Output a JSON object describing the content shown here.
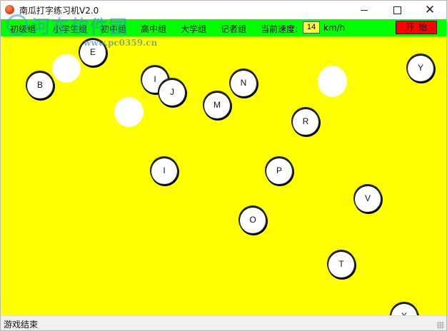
{
  "window": {
    "title": "南瓜打字练习机V2.0"
  },
  "menu": {
    "items": [
      "初级组",
      "小学生组",
      "初中组",
      "高中组",
      "大学组",
      "记者组"
    ],
    "speed_label": "当前速度:",
    "speed_value": "14",
    "speed_unit": "km/h",
    "start_label": "开始"
  },
  "watermark": {
    "text": "河东软件园",
    "url": "www.pc0359.cn"
  },
  "game": {
    "background_color": "#ffff00",
    "balls": [
      {
        "letter": "E"
      },
      {
        "letter": ""
      },
      {
        "letter": "B"
      },
      {
        "letter": "I"
      },
      {
        "letter": "J"
      },
      {
        "letter": "N"
      },
      {
        "letter": ""
      },
      {
        "letter": "Y"
      },
      {
        "letter": ""
      },
      {
        "letter": "M"
      },
      {
        "letter": "R"
      },
      {
        "letter": "I"
      },
      {
        "letter": "P"
      },
      {
        "letter": "V"
      },
      {
        "letter": "O"
      },
      {
        "letter": "T"
      },
      {
        "letter": "X"
      }
    ]
  },
  "status": {
    "text": "游戏结束"
  },
  "colors": {
    "menubar": "#00ff00",
    "start_button": "#ff0000",
    "speed_box": "#ffff33",
    "game_area": "#ffff00"
  },
  "icons": {
    "app": "pumpkin-icon",
    "minimize": "minimize-icon",
    "maximize": "maximize-icon",
    "close": "close-icon"
  }
}
